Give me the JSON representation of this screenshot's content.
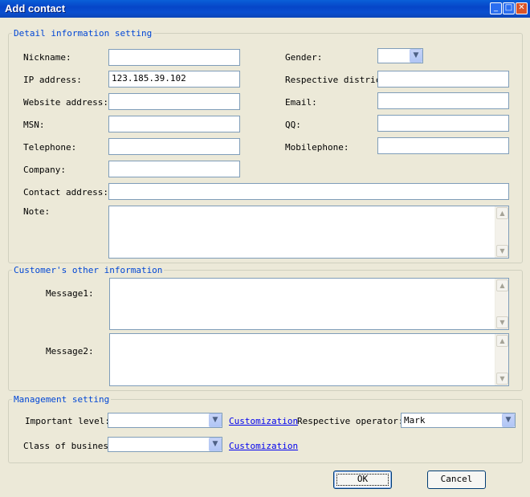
{
  "window": {
    "title": "Add contact",
    "controls": {
      "minimize": "_",
      "maximize": "□",
      "close": "✕"
    }
  },
  "detail": {
    "legend": "Detail information setting",
    "nickname": {
      "label": "Nickname:",
      "value": ""
    },
    "gender": {
      "label": "Gender:",
      "value": ""
    },
    "ip": {
      "label": "IP address:",
      "value": "123.185.39.102"
    },
    "district": {
      "label": "Respective district",
      "value": ""
    },
    "website": {
      "label": "Website address:",
      "value": ""
    },
    "email": {
      "label": "Email:",
      "value": ""
    },
    "msn": {
      "label": "MSN:",
      "value": ""
    },
    "qq": {
      "label": "QQ:",
      "value": ""
    },
    "telephone": {
      "label": "Telephone:",
      "value": ""
    },
    "mobilephone": {
      "label": "Mobilephone:",
      "value": ""
    },
    "company": {
      "label": "Company:",
      "value": ""
    },
    "contact_address": {
      "label": "Contact address:",
      "value": ""
    },
    "note": {
      "label": "Note:",
      "value": ""
    }
  },
  "other": {
    "legend": "Customer's other information",
    "message1": {
      "label": "Message1:",
      "value": ""
    },
    "message2": {
      "label": "Message2:",
      "value": ""
    }
  },
  "management": {
    "legend": "Management setting",
    "important_level": {
      "label": "Important level:",
      "value": ""
    },
    "customization_link_1": "Customization",
    "respective_operator": {
      "label": "Respective  operator:",
      "value": "Mark"
    },
    "class_of_business": {
      "label": "Class of business:",
      "value": ""
    },
    "customization_link_2": "Customization"
  },
  "buttons": {
    "ok": "OK",
    "cancel": "Cancel"
  }
}
